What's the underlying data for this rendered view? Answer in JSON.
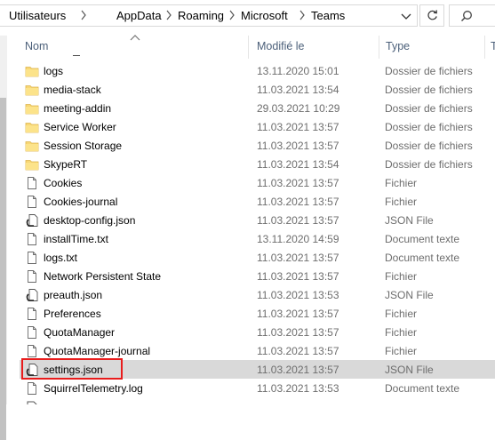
{
  "address": {
    "crumbs": [
      "Utilisateurs",
      "AppData",
      "Roaming",
      "Microsoft",
      "Teams"
    ]
  },
  "columns": {
    "name": "Nom",
    "modified": "Modifié le",
    "type": "Type",
    "size": "T"
  },
  "rows": [
    {
      "name": "logs",
      "date": "13.11.2020 15:01",
      "type": "Dossier de fichiers",
      "icon": "folder-icon"
    },
    {
      "name": "media-stack",
      "date": "11.03.2021 13:54",
      "type": "Dossier de fichiers",
      "icon": "folder-icon"
    },
    {
      "name": "meeting-addin",
      "date": "29.03.2021 10:29",
      "type": "Dossier de fichiers",
      "icon": "folder-icon"
    },
    {
      "name": "Service Worker",
      "date": "11.03.2021 13:57",
      "type": "Dossier de fichiers",
      "icon": "folder-icon"
    },
    {
      "name": "Session Storage",
      "date": "11.03.2021 13:57",
      "type": "Dossier de fichiers",
      "icon": "folder-icon"
    },
    {
      "name": "SkypeRT",
      "date": "11.03.2021 13:54",
      "type": "Dossier de fichiers",
      "icon": "folder-icon"
    },
    {
      "name": "Cookies",
      "date": "11.03.2021 13:57",
      "type": "Fichier",
      "icon": "file-icon"
    },
    {
      "name": "Cookies-journal",
      "date": "11.03.2021 13:57",
      "type": "Fichier",
      "icon": "file-icon"
    },
    {
      "name": "desktop-config.json",
      "date": "11.03.2021 13:57",
      "type": "JSON File",
      "icon": "json-file-icon"
    },
    {
      "name": "installTime.txt",
      "date": "13.11.2020 14:59",
      "type": "Document texte",
      "icon": "text-file-icon"
    },
    {
      "name": "logs.txt",
      "date": "11.03.2021 13:57",
      "type": "Document texte",
      "icon": "text-file-icon"
    },
    {
      "name": "Network Persistent State",
      "date": "11.03.2021 13:57",
      "type": "Fichier",
      "icon": "file-icon"
    },
    {
      "name": "preauth.json",
      "date": "11.03.2021 13:53",
      "type": "JSON File",
      "icon": "json-file-icon"
    },
    {
      "name": "Preferences",
      "date": "11.03.2021 13:57",
      "type": "Fichier",
      "icon": "file-icon"
    },
    {
      "name": "QuotaManager",
      "date": "11.03.2021 13:57",
      "type": "Fichier",
      "icon": "file-icon"
    },
    {
      "name": "QuotaManager-journal",
      "date": "11.03.2021 13:57",
      "type": "Fichier",
      "icon": "file-icon"
    },
    {
      "name": "settings.json",
      "date": "11.03.2021 13:57",
      "type": "JSON File",
      "icon": "json-file-icon",
      "selected": true
    },
    {
      "name": "SquirrelTelemetry.log",
      "date": "11.03.2021 13:53",
      "type": "Document texte",
      "icon": "text-file-icon"
    }
  ],
  "colors": {
    "selection": "#d9d9d9",
    "highlight_border": "#e81c1c",
    "folder": "#f8d775"
  }
}
